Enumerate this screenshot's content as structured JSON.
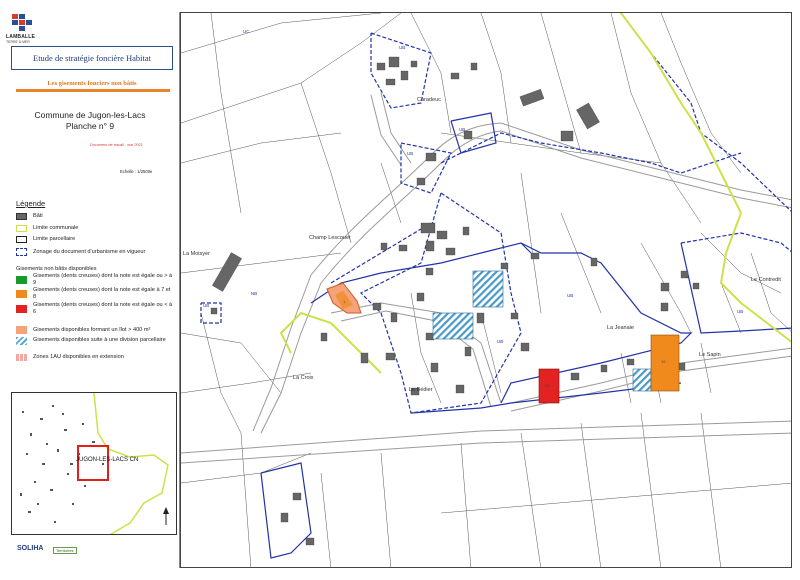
{
  "logo": {
    "name": "LAMBALLE",
    "sub": "TERRE & MER"
  },
  "header": {
    "title": "Etude de stratégie foncière Habitat",
    "subtitle": "Les gisements fonciers non bâtis",
    "commune_line1": "Commune de Jugon-les-Lacs",
    "commune_line2": "Planche n° 9",
    "document_note": "Document de travail - mai 2021",
    "scale": "Echelle : 1/2500e"
  },
  "legend": {
    "title": "Légende",
    "items": [
      {
        "label": "Bâti"
      },
      {
        "label": "Limite communale"
      },
      {
        "label": "Limite parcellaire"
      },
      {
        "label": "Zonage du document d'urbanisme en vigueur"
      }
    ],
    "section_title": "Gisements non bâtis disponibles",
    "gisements": [
      {
        "label": "Gisements (dents creuses) dont la note est égale ou > à 9",
        "color": "#1a9a2a"
      },
      {
        "label": "Gisements (dents creuses) dont la note est égale à 7 et 8",
        "color": "#f08a1c"
      },
      {
        "label": "Gisements (dents creuses) dont la note est égale ou < à 6",
        "color": "#e32222"
      },
      {
        "label": "Gisements disponibles formant un îlot > 400 m²",
        "color": "#f4a37a"
      },
      {
        "label": "Gisements disponibles suite à une division parcellaire",
        "color": "#5aaad0"
      },
      {
        "label": "Zones 1AU disponibles en extension",
        "color": "#f2a8a0"
      }
    ]
  },
  "colors": {
    "bati": "#666666",
    "limite_communale": "#cfe04a",
    "zonage": "#2233aa",
    "road": "#9a9a9a"
  },
  "inset": {
    "label": "JUGON-LES-LACS CN"
  },
  "footer": {
    "logo1": "SOLIHA",
    "logo2": "Territoires"
  },
  "map": {
    "places": {
      "caradeuc": "Caradeuc",
      "champ_lescouet": "Champ Lescouet",
      "la_croix": "La Croix",
      "le_bedier": "Le Bédier",
      "la_jeanaie": "La Jeanaie",
      "le_sapin": "Le Sapin",
      "le_contredit": "Le Contredit",
      "la_moisyer": "La Moisyer"
    },
    "gisement_labels": {
      "orange_island": "1",
      "red": "20",
      "orange_right": "10"
    },
    "zone_labels": [
      "UC",
      "UB",
      "UB",
      "UB",
      "UB",
      "UB",
      "UB",
      "NB",
      "UB"
    ]
  }
}
